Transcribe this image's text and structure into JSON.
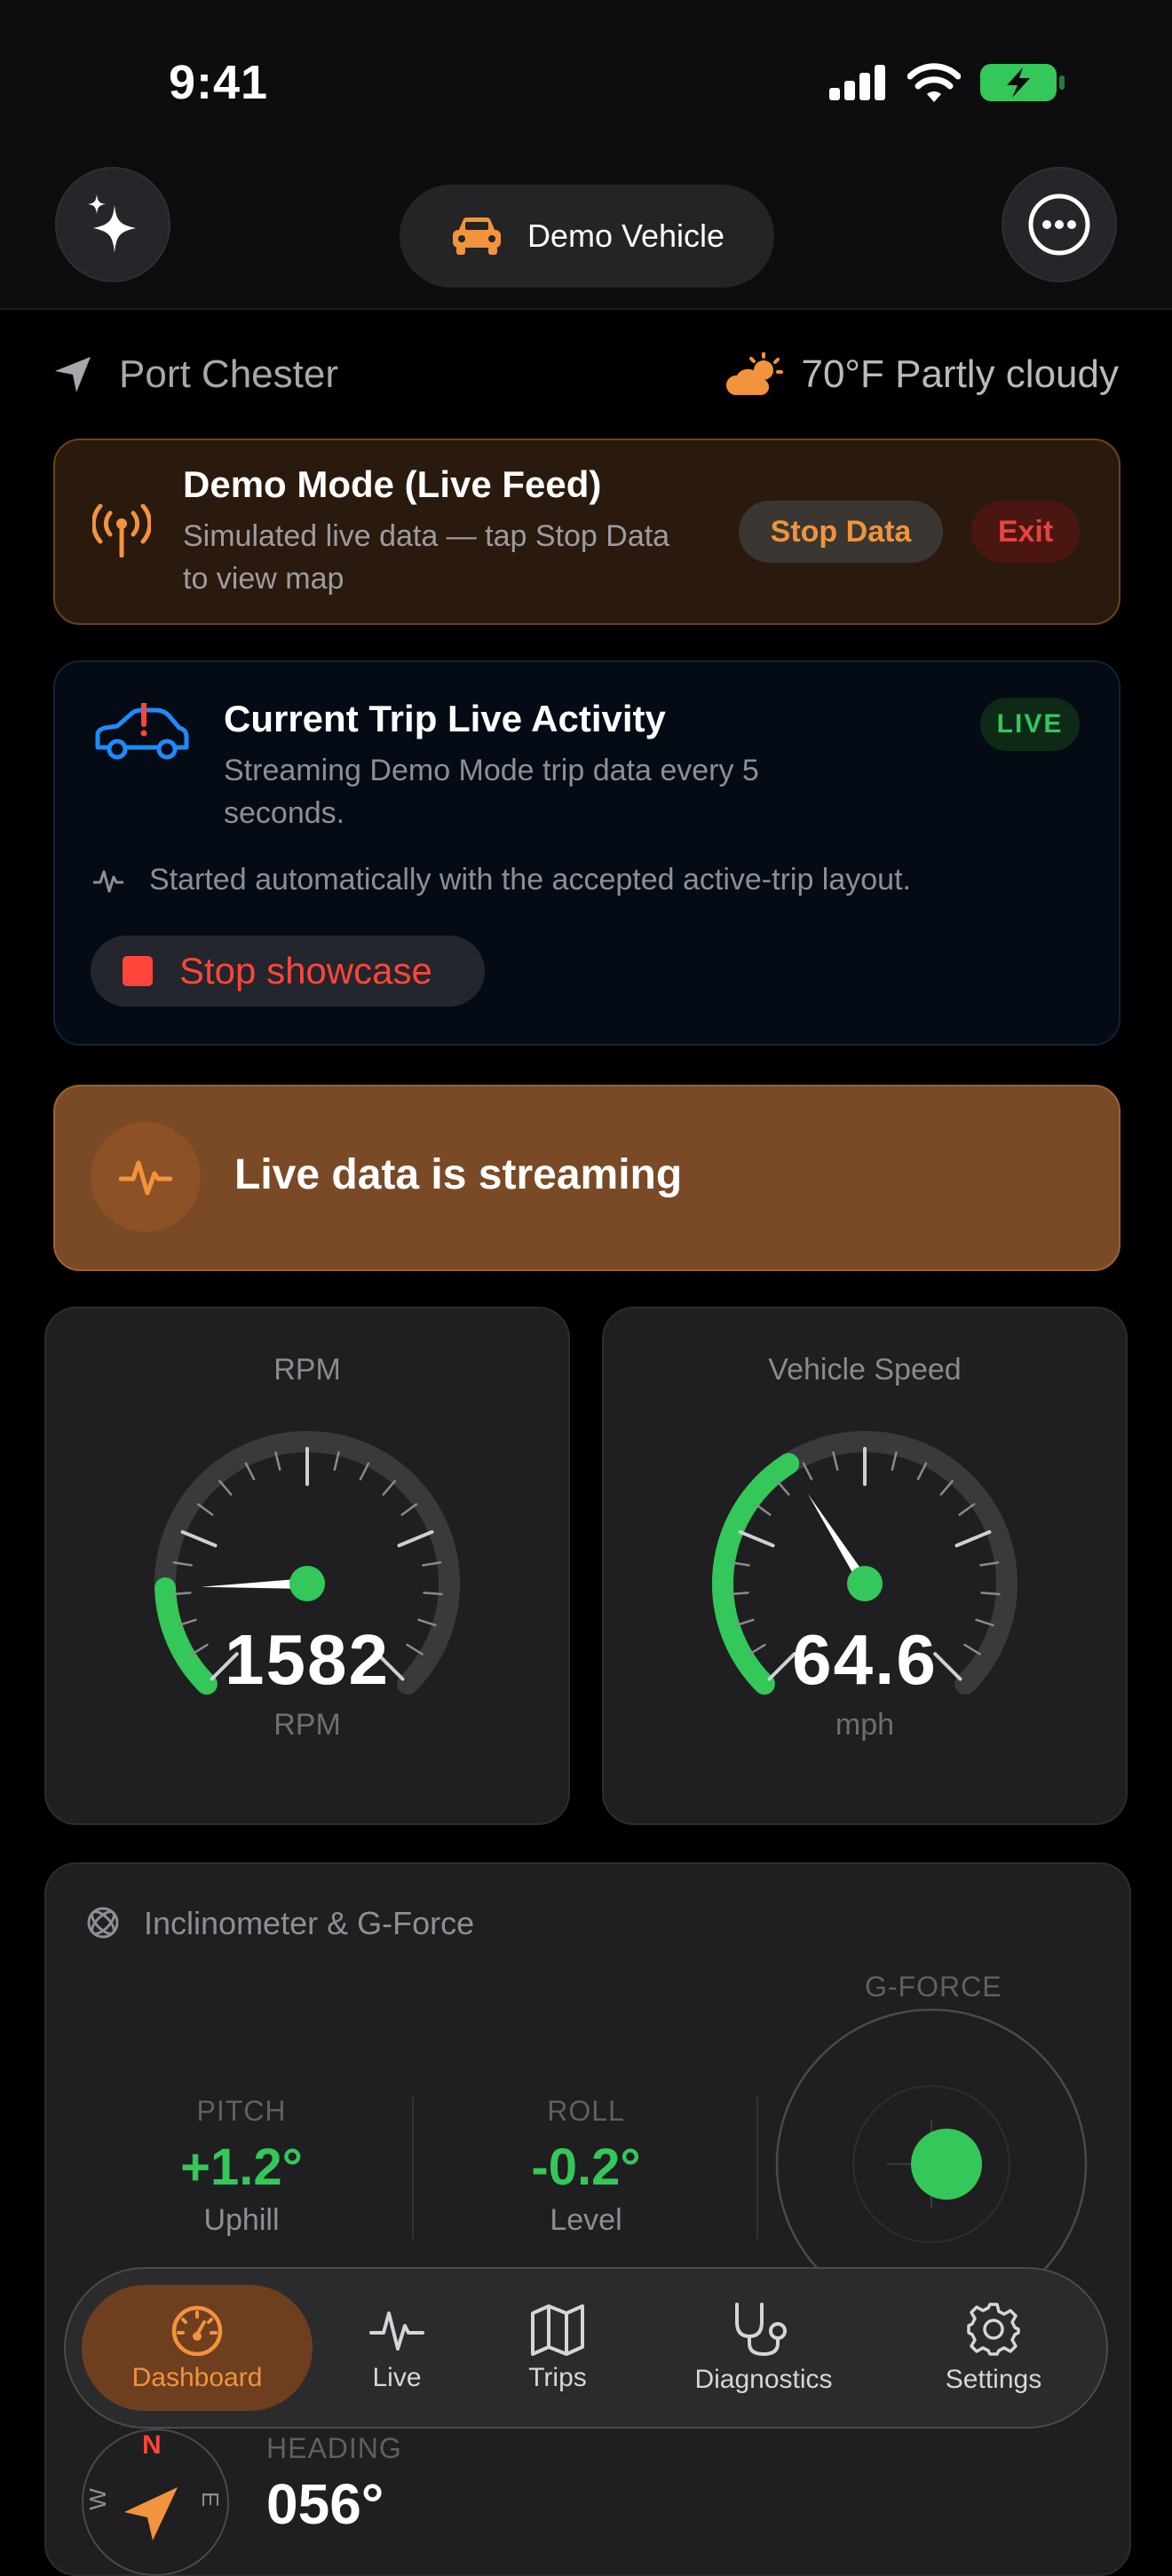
{
  "status_bar": {
    "time": "9:41"
  },
  "header": {
    "vehicle_name": "Demo Vehicle"
  },
  "location": {
    "city": "Port Chester",
    "weather": "70°F Partly cloudy"
  },
  "demo_banner": {
    "title": "Demo Mode (Live Feed)",
    "subtitle": "Simulated live data — tap Stop Data to view map",
    "stop_label": "Stop Data",
    "exit_label": "Exit"
  },
  "live_activity": {
    "title": "Current Trip Live Activity",
    "subtitle": "Streaming Demo Mode trip data every 5 seconds.",
    "badge": "LIVE",
    "note": "Started automatically with the accepted active-trip layout.",
    "stop_label": "Stop showcase"
  },
  "streaming": {
    "message": "Live data is streaming"
  },
  "gauges": [
    {
      "label": "RPM",
      "value": "1582",
      "unit": "RPM",
      "fraction": 0.16
    },
    {
      "label": "Vehicle Speed",
      "value": "64.6",
      "unit": "mph",
      "fraction": 0.38
    }
  ],
  "inclinometer": {
    "title": "Inclinometer & G-Force",
    "pitch": {
      "label": "PITCH",
      "value": "+1.2°",
      "sub": "Uphill"
    },
    "roll": {
      "label": "ROLL",
      "value": "-0.2°",
      "sub": "Level"
    },
    "gforce_label": "G-FORCE"
  },
  "heading": {
    "label": "HEADING",
    "value": "056°",
    "compass_n": "N",
    "compass_e": "E",
    "compass_w": "W"
  },
  "tabs": [
    {
      "label": "Dashboard",
      "icon": "gauge-icon"
    },
    {
      "label": "Live",
      "icon": "pulse-icon"
    },
    {
      "label": "Trips",
      "icon": "map-icon"
    },
    {
      "label": "Diagnostics",
      "icon": "stethoscope-icon"
    },
    {
      "label": "Settings",
      "icon": "gear-icon"
    }
  ],
  "colors": {
    "accent": "#f2933d",
    "green": "#34c759",
    "red": "#ff453a"
  }
}
